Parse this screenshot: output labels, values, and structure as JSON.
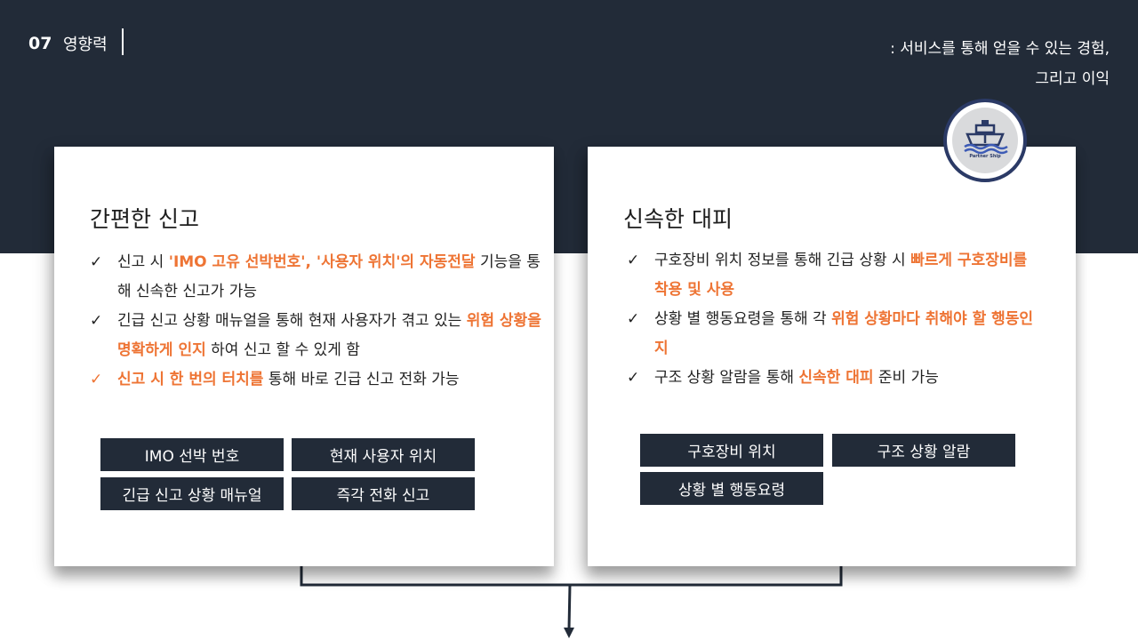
{
  "header": {
    "section_number": "07",
    "section_title": "영향력",
    "subtitle_line1": ": 서비스를 통해 얻을 수 있는 경험,",
    "subtitle_line2": "그리고 이익"
  },
  "logo": {
    "label": "Partner Ship",
    "icon": "ship-icon"
  },
  "left_card": {
    "title": "간편한 신고",
    "bullets": [
      {
        "check_color": "dark",
        "parts": [
          "신고 시 ",
          "'IMO 고유 선박번호', '사용자 위치'의 자동전달",
          " 기능을 통해 신속한 신고가 가능"
        ]
      },
      {
        "check_color": "dark",
        "parts": [
          " 긴급 신고 상황 매뉴얼을 통해 현재 사용자가 겪고 있는 ",
          "위험 상황을 명확하게 인지",
          " 하여 신고 할 수 있게 함"
        ]
      },
      {
        "check_color": "orange",
        "parts": [
          "신고 시 한 번의 터치를",
          " 통해 바로 긴급 신고 전화 가능"
        ]
      }
    ],
    "tags": [
      "IMO 선박 번호",
      "현재 사용자 위치",
      "긴급 신고 상황 매뉴얼",
      "즉각 전화 신고"
    ]
  },
  "right_card": {
    "title": "신속한 대피",
    "bullets": [
      {
        "check_color": "dark",
        "parts": [
          "구호장비 위치 정보를 통해 긴급 상황 시 ",
          "빠르게 구호장비를 착용 및 사용"
        ]
      },
      {
        "check_color": "dark",
        "parts": [
          "상황 별 행동요령을 통해 각 ",
          "위험 상황마다 취해야 할 행동인지"
        ]
      },
      {
        "check_color": "dark",
        "parts": [
          "구조 상황 알람을 통해 ",
          "신속한 대피",
          " 준비 가능"
        ]
      }
    ],
    "tags": [
      "구호장비 위치",
      "구조 상황 알람",
      "상황 별 행동요령"
    ]
  },
  "colors": {
    "navy": "#222b38",
    "accent": "#ee7434",
    "logo_ring": "#2b3a66"
  }
}
